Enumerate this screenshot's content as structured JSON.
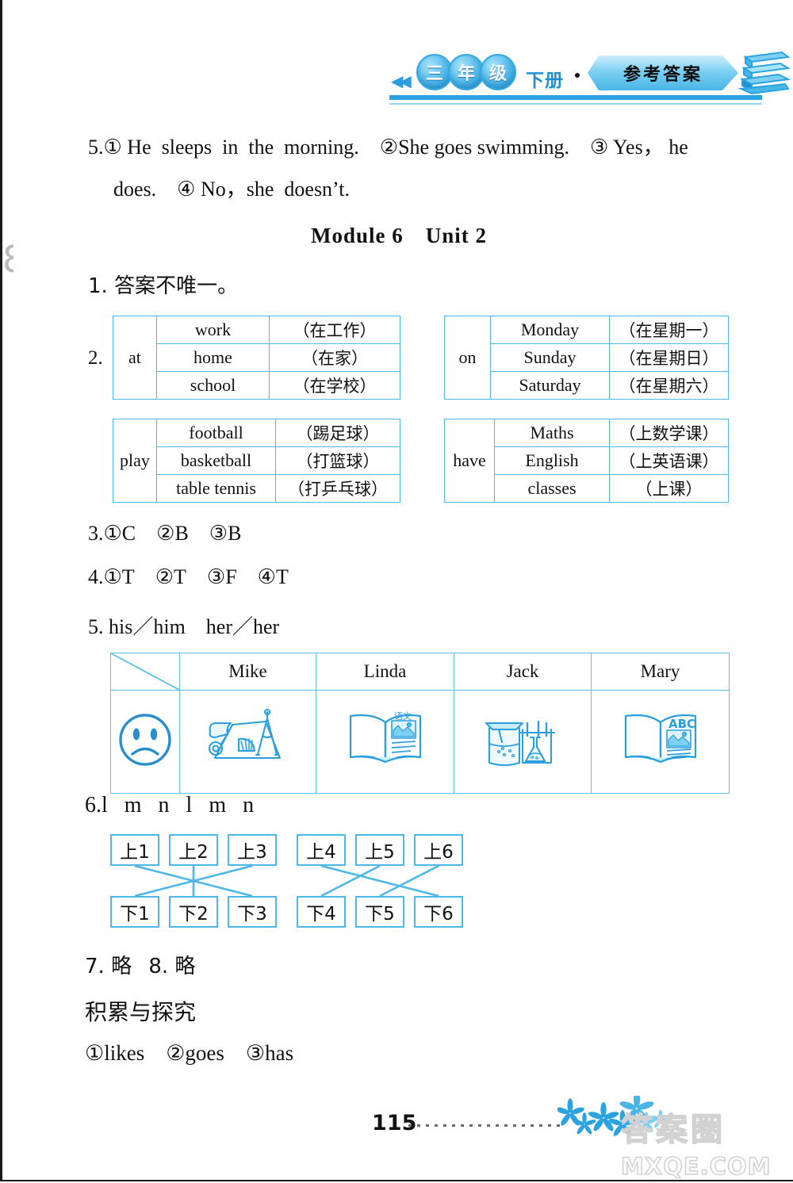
{
  "header": {
    "nav_arrows": "◀◀",
    "grade_chars": [
      "三",
      "年",
      "级"
    ],
    "volume": "下册",
    "separator_dot": "·",
    "banner_label": "参考答案",
    "books_icon": "stacked-books-icon"
  },
  "content": {
    "q5_prev_line1": "5.① He  sleeps  in  the  morning.  ②She goes swimming.  ③ Yes， he",
    "q5_prev_line2": "does.  ④ No，she  doesn’t.",
    "module_title": "Module 6 Unit 2",
    "q1": "1. 答案不唯一。",
    "q2_label": "2.",
    "q2_tables": [
      {
        "key": "at",
        "rows": [
          {
            "word": "work",
            "cn": "（在工作）"
          },
          {
            "word": "home",
            "cn": "（在家）"
          },
          {
            "word": "school",
            "cn": "（在学校）"
          }
        ]
      },
      {
        "key": "on",
        "rows": [
          {
            "word": "Monday",
            "cn": "（在星期一）"
          },
          {
            "word": "Sunday",
            "cn": "（在星期日）"
          },
          {
            "word": "Saturday",
            "cn": "（在星期六）"
          }
        ]
      },
      {
        "key": "play",
        "rows": [
          {
            "word": "football",
            "cn": "（踢足球）"
          },
          {
            "word": "basketball",
            "cn": "（打篮球）"
          },
          {
            "word": "table  tennis",
            "cn": "（打乒乓球）"
          }
        ]
      },
      {
        "key": "have",
        "rows": [
          {
            "word": "Maths",
            "cn": "（上数学课）"
          },
          {
            "word": "English",
            "cn": "（上英语课）"
          },
          {
            "word": "classes",
            "cn": "（上课）"
          }
        ]
      }
    ],
    "q3": "3.①C  ②B  ③B",
    "q4": "4.①T  ②T  ③F  ④T",
    "q5": "5. his／him  her／her",
    "names_table": {
      "corner": "diagonal-split-cell",
      "names": [
        "Mike",
        "Linda",
        "Jack",
        "Mary"
      ],
      "icons": [
        "sad-face-icon",
        "maths-tools-icon",
        "chinese-book-icon",
        "science-beaker-icon",
        "english-book-icon"
      ],
      "icon_labels": [
        "",
        "",
        "语文",
        "",
        "ABC"
      ]
    },
    "q6": "6.l  m  n  l  m  n",
    "match": {
      "top": [
        "上1",
        "上2",
        "上3",
        "上4",
        "上5",
        "上6"
      ],
      "bottom": [
        "下1",
        "下2",
        "下3",
        "下4",
        "下5",
        "下6"
      ],
      "pairs": [
        [
          0,
          2
        ],
        [
          1,
          1
        ],
        [
          2,
          0
        ],
        [
          3,
          5
        ],
        [
          4,
          3
        ],
        [
          5,
          4
        ]
      ]
    },
    "q78": "7. 略  8. 略",
    "section_title": "积累与探究",
    "section_answers": "①likes  ②goes  ③has"
  },
  "footer": {
    "page_number": "115",
    "dots": "dotted-leader",
    "flowers_icon": "flower-decoration-icon",
    "watermark_char": "答案圈",
    "watermark_url": "MXQE.COM"
  },
  "colors": {
    "accent_blue": "#2ba3e0",
    "table_border": "#4db8e8",
    "ink": "#111111",
    "watermark_grey": "#d2d2d2"
  }
}
